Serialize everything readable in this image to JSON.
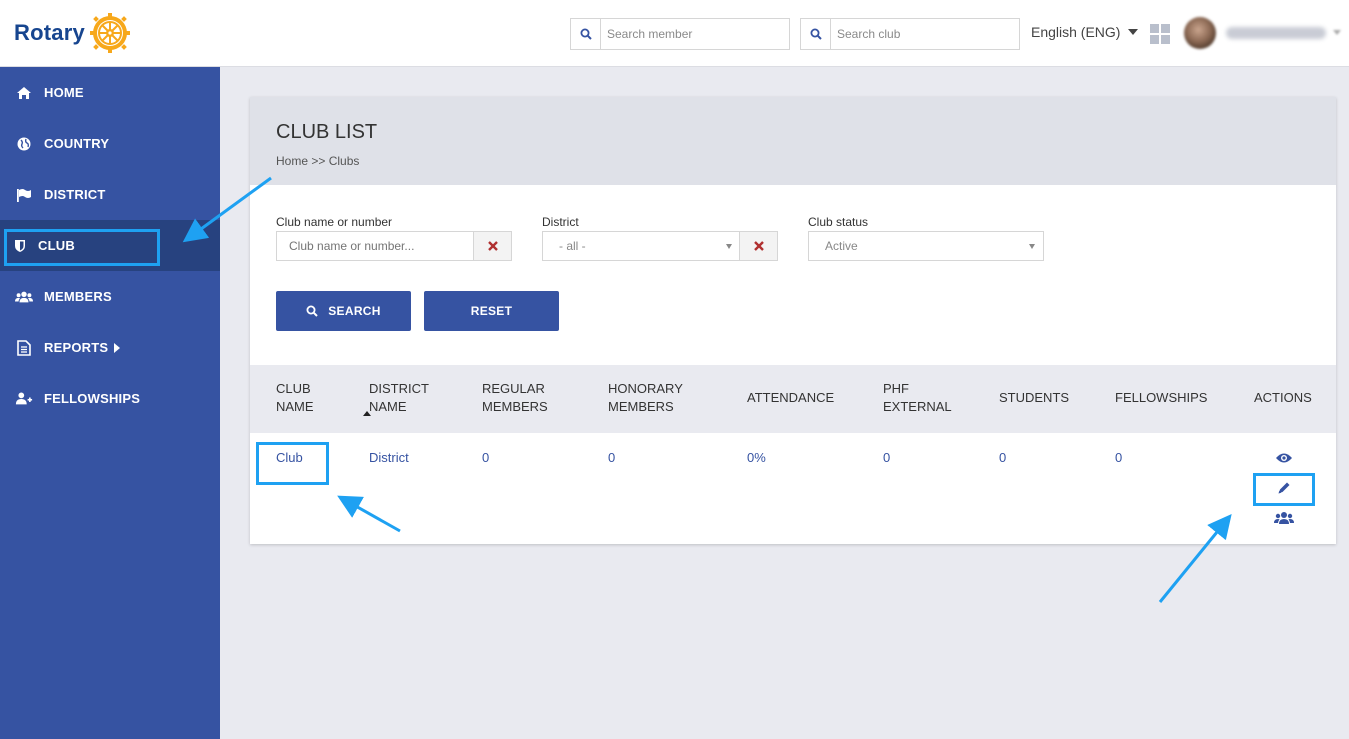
{
  "header": {
    "logo_text": "Rotary",
    "search_member_placeholder": "Search member",
    "search_club_placeholder": "Search club",
    "language": "English (ENG)"
  },
  "sidebar": {
    "items": [
      {
        "label": "HOME",
        "icon": "home-icon"
      },
      {
        "label": "COUNTRY",
        "icon": "globe-icon"
      },
      {
        "label": "DISTRICT",
        "icon": "flag-icon"
      },
      {
        "label": "CLUB",
        "icon": "shield-icon",
        "active": true
      },
      {
        "label": "MEMBERS",
        "icon": "users-icon"
      },
      {
        "label": "REPORTS",
        "icon": "document-icon",
        "has_submenu": true
      },
      {
        "label": "FELLOWSHIPS",
        "icon": "user-plus-icon"
      }
    ]
  },
  "page": {
    "title": "CLUB LIST",
    "breadcrumb": "Home >> Clubs"
  },
  "filters": {
    "club_label": "Club name or number",
    "club_placeholder": "Club name or number...",
    "district_label": "District",
    "district_value": "- all -",
    "status_label": "Club status",
    "status_value": "Active",
    "search_button": "SEARCH",
    "reset_button": "RESET"
  },
  "table": {
    "headers": {
      "club_name": [
        "CLUB",
        "NAME"
      ],
      "district_name": [
        "DISTRICT",
        "NAME"
      ],
      "regular_members": [
        "REGULAR",
        "MEMBERS"
      ],
      "honorary_members": [
        "HONORARY",
        "MEMBERS"
      ],
      "attendance": [
        "ATTENDANCE"
      ],
      "phf_external": [
        "PHF",
        "EXTERNAL"
      ],
      "students": [
        "STUDENTS"
      ],
      "fellowships": [
        "FELLOWSHIPS"
      ],
      "actions": [
        "ACTIONS"
      ]
    },
    "rows": [
      {
        "club": "Club",
        "district": "District",
        "regular_members": "0",
        "honorary_members": "0",
        "attendance": "0%",
        "phf_external": "0",
        "students": "0",
        "fellowships": "0",
        "actions": [
          "eye-icon",
          "pencil-icon",
          "users-icon"
        ]
      }
    ]
  },
  "colors": {
    "primary": "#3653a2",
    "sidebar_active": "#27427f",
    "highlight": "#1ea1f2",
    "danger_x": "#b03030",
    "rotary_gold": "#f7a81b"
  }
}
